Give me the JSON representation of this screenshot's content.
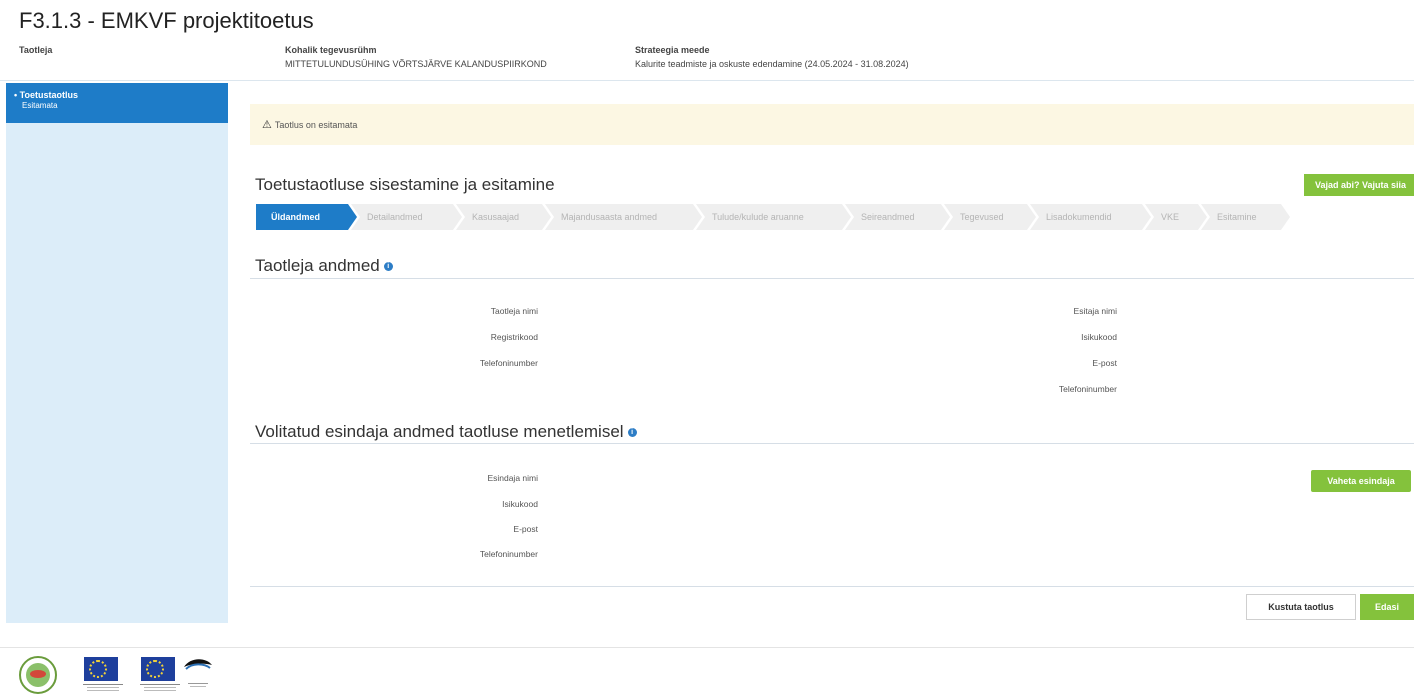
{
  "page": {
    "title": "F3.1.3 - EMKVF projektitoetus"
  },
  "header": {
    "applicant_label": "Taotleja",
    "local_group_label": "Kohalik tegevusrühm",
    "local_group_value": "MITTETULUNDUSÜHING VÕRTSJÄRVE KALANDUSPIIRKOND",
    "measure_label": "Strateegia meede",
    "measure_value": "Kalurite teadmiste ja oskuste edendamine (24.05.2024 - 31.08.2024)"
  },
  "sidebar": {
    "items": [
      {
        "label": "Toetustaotlus",
        "status": "Esitamata"
      }
    ]
  },
  "alert": {
    "text": "Taotlus on esitamata",
    "icon": "warning-icon"
  },
  "main": {
    "title": "Toetustaotluse sisestamine ja esitamine",
    "help_button": "Vajad abi? Vajuta siia",
    "steps": [
      "Üldandmed",
      "Detailandmed",
      "Kasusaajad",
      "Majandusaasta andmed",
      "Tulude/kulude aruanne",
      "Seireandmed",
      "Tegevused",
      "Lisadokumendid",
      "VKE",
      "Esitamine"
    ],
    "active_step": 0
  },
  "applicant_section": {
    "title": "Taotleja andmed",
    "left_fields": [
      "Taotleja nimi",
      "Registrikood",
      "Telefoninumber"
    ],
    "right_fields": [
      "Esitaja nimi",
      "Isikukood",
      "E-post",
      "Telefoninumber"
    ]
  },
  "representative_section": {
    "title": "Volitatud esindaja andmed taotluse menetlemisel",
    "fields": [
      "Esindaja nimi",
      "Isikukood",
      "E-post",
      "Telefoninumber"
    ],
    "change_button": "Vaheta esindaja"
  },
  "actions": {
    "delete_button": "Kustuta taotlus",
    "next_button": "Edasi"
  },
  "colors": {
    "primary_blue": "#1e7cc8",
    "sidebar_bg": "#dcedf9",
    "accent_green": "#84c23c",
    "alert_bg": "#fcf7e3"
  }
}
